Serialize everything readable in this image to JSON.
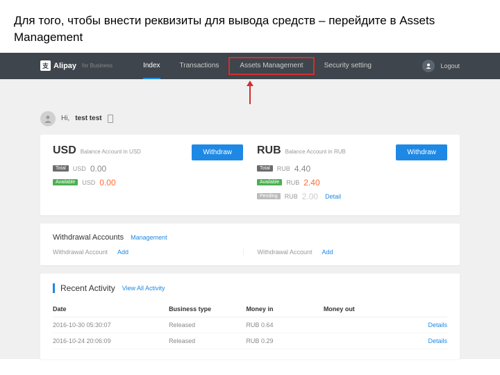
{
  "instruction": "Для того, чтобы внести реквизиты для вывода средств – перейдите в Assets Management",
  "brand": {
    "badge": "支",
    "name": "Alipay",
    "sub": "for Business"
  },
  "nav": {
    "items": [
      "Index",
      "Transactions",
      "Assets Management",
      "Security setting"
    ],
    "logout": "Logout"
  },
  "greeting": {
    "hi": "Hi,",
    "name": "test test"
  },
  "balances": {
    "usd": {
      "code": "USD",
      "sub": "Balance Account in USD",
      "total_label": "Total",
      "total_cur": "USD",
      "total_val": "0.00",
      "avail_label": "Available",
      "avail_cur": "USD",
      "avail_val": "0.00",
      "withdraw": "Withdraw"
    },
    "rub": {
      "code": "RUB",
      "sub": "Balance Account in RUB",
      "total_label": "Total",
      "total_cur": "RUB",
      "total_val": "4.40",
      "avail_label": "Available",
      "avail_cur": "RUB",
      "avail_val": "2.40",
      "pend_label": "Pending",
      "pend_cur": "RUB",
      "pend_val": "2.00",
      "detail": "Detail",
      "withdraw": "Withdraw"
    }
  },
  "withdrawal": {
    "title": "Withdrawal Accounts",
    "manage": "Management",
    "col_label": "Withdrawal Account",
    "add": "Add"
  },
  "recent": {
    "title": "Recent Activity",
    "view_all": "View All Activity",
    "headers": {
      "date": "Date",
      "type": "Business type",
      "in": "Money in",
      "out": "Money out"
    },
    "rows": [
      {
        "date": "2016-10-30 05:30:07",
        "type": "Released",
        "in": "RUB 0.64",
        "out": "",
        "link": "Details"
      },
      {
        "date": "2016-10-24 20:06:09",
        "type": "Released",
        "in": "RUB 0.29",
        "out": "",
        "link": "Details"
      }
    ]
  }
}
